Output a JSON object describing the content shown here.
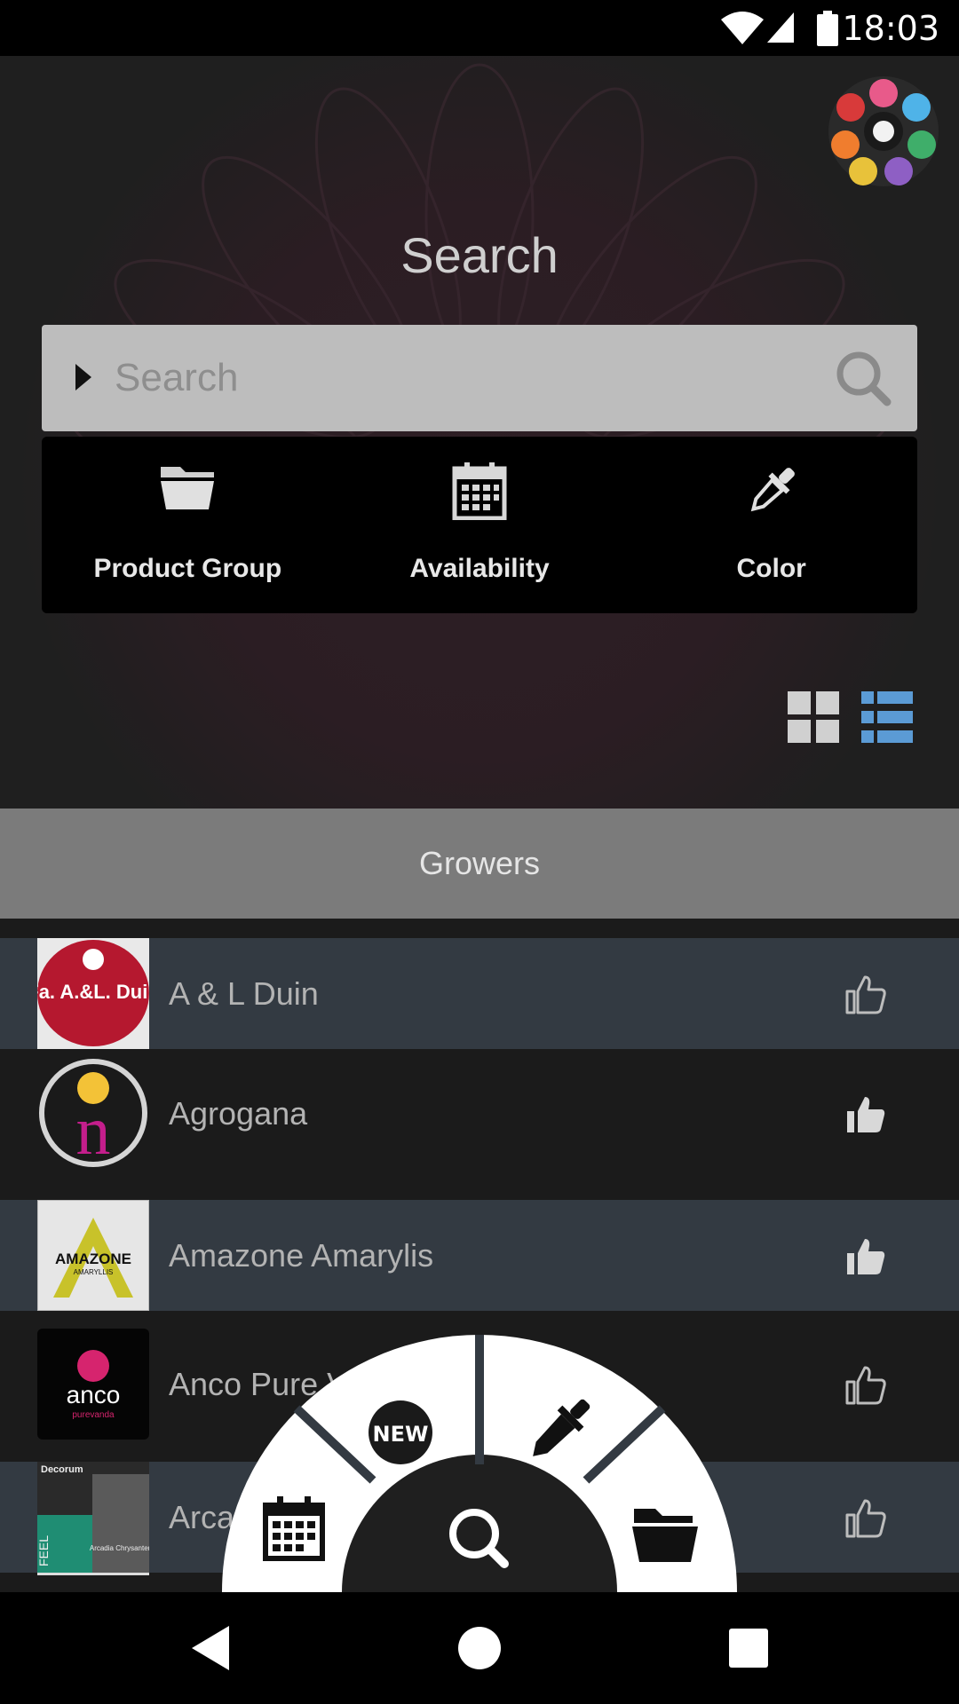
{
  "status_bar": {
    "time": "18:03"
  },
  "hero": {
    "title": "Search"
  },
  "search": {
    "placeholder": "Search"
  },
  "filters": [
    {
      "label": "Product Group",
      "icon": "folder-icon"
    },
    {
      "label": "Availability",
      "icon": "calendar-icon"
    },
    {
      "label": "Color",
      "icon": "color-picker-icon"
    }
  ],
  "section": {
    "title": "Growers"
  },
  "growers": [
    {
      "name": "A & L Duin",
      "liked": false,
      "logo_text": "Fa. A.&L. Duin"
    },
    {
      "name": "Agrogana",
      "liked": true,
      "logo_text": "n"
    },
    {
      "name": "Amazone Amarylis",
      "liked": true,
      "logo_text": "AMAZONE",
      "logo_subtext": "AMARYLLIS"
    },
    {
      "name": "Anco Pure Vanda",
      "liked": false,
      "logo_text": "anco",
      "logo_subtext": "purevanda"
    },
    {
      "name": "Arcadia Chrysanten",
      "liked": false,
      "logo_text": "Decorum",
      "logo_subtext": "FEEL",
      "logo_caption": "Arcadia Chrysanten"
    }
  ],
  "radial_menu": {
    "new_label": "NEW"
  },
  "colors": {
    "accent_blue": "#5b9bd5",
    "row_alt": "#333a42",
    "header_gray": "#7b7b7b"
  }
}
